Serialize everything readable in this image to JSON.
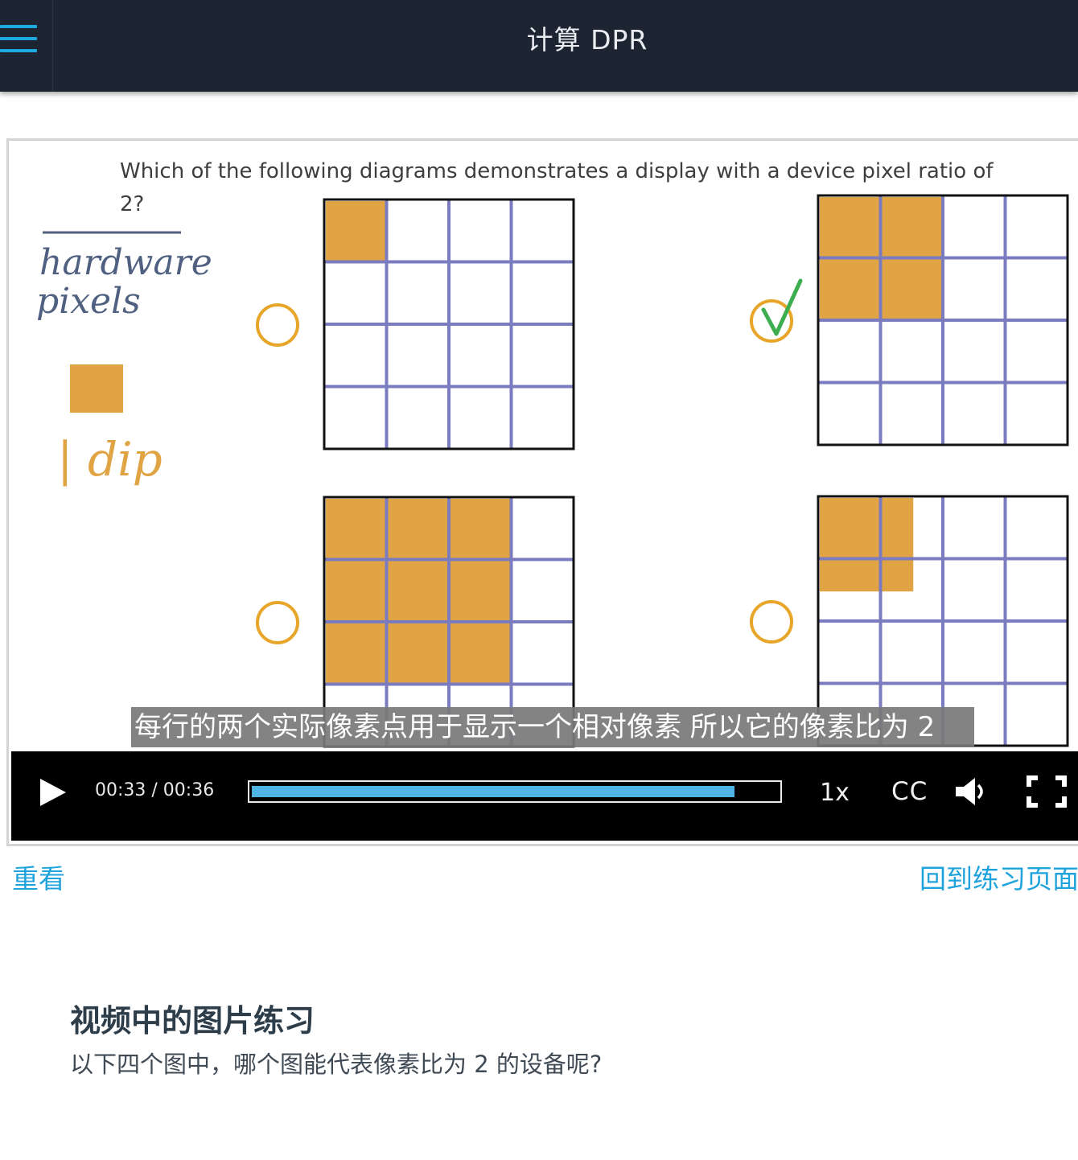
{
  "header": {
    "title": "计算 DPR",
    "menu_icon": "hamburger-menu-icon"
  },
  "video": {
    "question_line1": "Which of the following diagrams demonstrates a display with a device pixel ratio of",
    "question_line2": "2?",
    "legend_label_1": "hardware",
    "legend_label_2": "pixels",
    "legend_dip": "| dip",
    "subtitle": "每行的两个实际像素点用于显示一个相对像素 所以它的像素比为 2",
    "colors": {
      "fill": "#e1a445",
      "grid": "#7b7cc0",
      "circle": "#e7a52a",
      "check": "#3dae4f",
      "ink": "#506080"
    },
    "options": [
      {
        "filled_rows": 1,
        "filled_cols": 1,
        "selected": false
      },
      {
        "filled_rows": 2,
        "filled_cols": 2,
        "selected": true
      },
      {
        "filled_rows": 3,
        "filled_cols": 3,
        "selected": false
      },
      {
        "filled_rows": 1.5,
        "filled_cols": 1.5,
        "selected": false
      }
    ]
  },
  "controls": {
    "time": "00:33 / 00:36",
    "current_seconds": 33,
    "duration_seconds": 36,
    "speed": "1x",
    "cc": "CC",
    "play_icon": "play-icon",
    "volume_icon": "volume-icon",
    "fullscreen_icon": "fullscreen-icon"
  },
  "links": {
    "rewatch": "重看",
    "back": "回到练习页面"
  },
  "section": {
    "title": "视频中的图片练习",
    "description": "以下四个图中，哪个图能代表像素比为 2 的设备呢?"
  }
}
